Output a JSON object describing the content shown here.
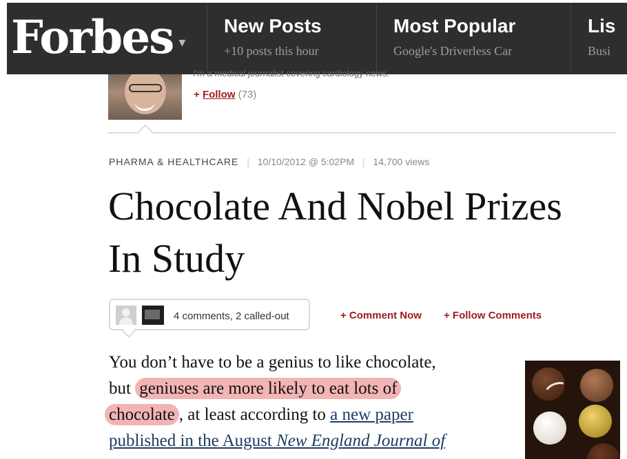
{
  "nav": {
    "logo": "Forbes",
    "logo_caret": "▾",
    "items": [
      {
        "title": "New Posts",
        "subtitle": "+10 posts this hour"
      },
      {
        "title": "Most Popular",
        "subtitle": "Google's Driverless Car"
      },
      {
        "title": "Lis",
        "subtitle": "Busi"
      }
    ]
  },
  "author": {
    "bio": "I'm a medical journalist covering cardiology news.",
    "follow_plus": "+",
    "follow_label": "Follow",
    "follow_count": "(73)"
  },
  "meta": {
    "category": "PHARMA & HEALTHCARE",
    "date": "10/10/2012 @ 5:02PM",
    "views": "14,700 views"
  },
  "article": {
    "title_line1": "Chocolate And Nobel Prizes",
    "title_line2": "In Study"
  },
  "comments": {
    "summary": "4 comments, 2 called-out",
    "comment_now": "+ Comment Now",
    "follow_comments": "+ Follow Comments"
  },
  "body": {
    "l1": "You don’t have to be a genius to like chocolate,",
    "l2_pre": "but ",
    "l2_hl": "geniuses are more likely to eat lots of",
    "l3_hl": "chocolate",
    "l3_mid": ", at least according to ",
    "l3_link": "a new paper",
    "l4_link": "published in the August ",
    "l4_italic": "New England Journal of"
  },
  "colors": {
    "nav_bg": "#2e2e2e",
    "accent_red": "#a01c1c",
    "highlight": "#f2b4b4",
    "link": "#1f3a66"
  }
}
